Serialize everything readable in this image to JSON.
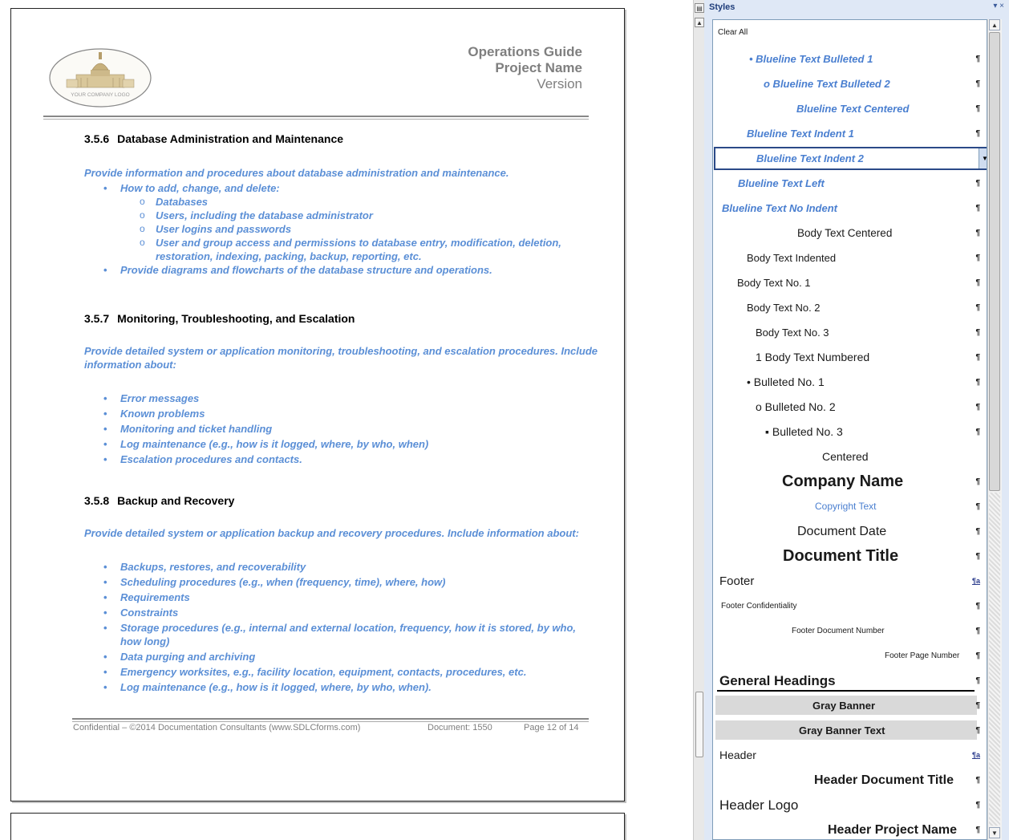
{
  "document": {
    "header": {
      "logo_text": "YOUR COMPANY LOGO",
      "guide_title": "Operations Guide",
      "project_name": "Project Name",
      "version": "Version"
    },
    "sections": [
      {
        "number": "3.5.6",
        "title": "Database Administration and Maintenance",
        "intro": "Provide information and procedures about database administration and maintenance.",
        "bullet1": "How to add, change, and delete:",
        "subitems": [
          "Databases",
          "Users, including the database administrator",
          "User logins and passwords",
          "User and group access and permissions to database entry, modification, deletion, restoration, indexing, packing, backup, reporting, etc."
        ],
        "bullet2": "Provide diagrams and flowcharts of the database structure and operations."
      },
      {
        "number": "3.5.7",
        "title": "Monitoring, Troubleshooting, and Escalation",
        "intro": "Provide detailed system or application monitoring, troubleshooting, and escalation procedures. Include information about:",
        "items": [
          "Error messages",
          "Known problems",
          "Monitoring and ticket handling",
          "Log maintenance (e.g., how is it logged, where, by who, when)",
          "Escalation procedures and contacts."
        ]
      },
      {
        "number": "3.5.8",
        "title": "Backup and Recovery",
        "intro": "Provide detailed system or application backup and recovery procedures. Include information about:",
        "items": [
          "Backups, restores, and recoverability",
          "Scheduling procedures (e.g., when (frequency, time), where, how)",
          "Requirements",
          "Constraints",
          "Storage procedures (e.g., internal and external location, frequency, how it is stored, by who, how long)",
          "Data purging and archiving",
          "Emergency worksites, e.g., facility location, equipment, contacts, procedures, etc.",
          "Log maintenance (e.g., how is it logged, where, by who, when)."
        ]
      }
    ],
    "footer": {
      "confidential": "Confidential – ©2014 Documentation Consultants (www.SDLCforms.com)",
      "doc_number": "Document: 1550",
      "page": "Page 12 of 14"
    }
  },
  "styles_pane": {
    "title": "Styles",
    "controls": "▾ ×",
    "clear_all": "Clear All",
    "pilcrow": "¶",
    "link_mark": "¶a",
    "items": [
      {
        "label": "• Blueline Text Bulleted 1"
      },
      {
        "label": "o    Blueline Text Bulleted 2"
      },
      {
        "label": "Blueline Text Centered"
      },
      {
        "label": "Blueline Text Indent 1"
      },
      {
        "label": "Blueline Text Indent 2",
        "selected": true
      },
      {
        "label": "Blueline Text Left"
      },
      {
        "label": "Blueline Text No Indent"
      },
      {
        "label": "Body Text Centered"
      },
      {
        "label": "Body Text Indented"
      },
      {
        "label": "Body Text No. 1"
      },
      {
        "label": "Body Text No. 2"
      },
      {
        "label": "Body Text No. 3"
      },
      {
        "label": "1  Body Text Numbered"
      },
      {
        "label": "• Bulleted No. 1"
      },
      {
        "label": "o    Bulleted No. 2"
      },
      {
        "label": "▪       Bulleted No. 3"
      },
      {
        "label": "Centered"
      },
      {
        "label": "Company Name"
      },
      {
        "label": "Copyright Text"
      },
      {
        "label": "Document Date"
      },
      {
        "label": "Document Title"
      },
      {
        "label": "Footer"
      },
      {
        "label": "Footer Confidentiality"
      },
      {
        "label": "Footer Document Number"
      },
      {
        "label": "Footer Page Number"
      },
      {
        "label": "General Headings"
      },
      {
        "label": "Gray Banner"
      },
      {
        "label": "Gray Banner Text"
      },
      {
        "label": "Header"
      },
      {
        "label": "Header Document Title"
      },
      {
        "label": "Header Logo"
      },
      {
        "label": "Header Project Name"
      }
    ]
  },
  "colors": {
    "blueline": "#5b8fd6",
    "pane_background": "#dfe8f6",
    "selection_border": "#2b4a88"
  }
}
